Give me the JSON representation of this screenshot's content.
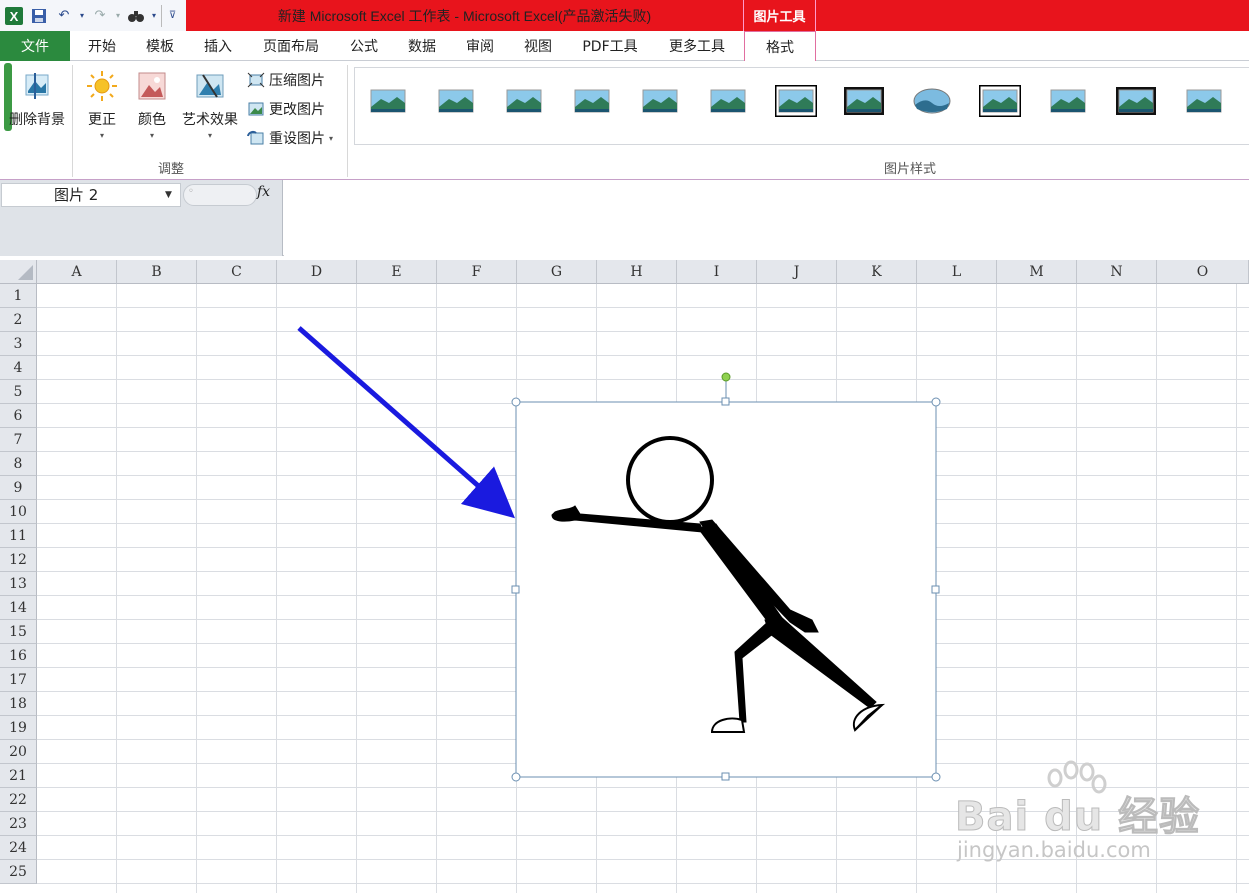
{
  "window": {
    "title": "新建 Microsoft Excel 工作表 - Microsoft Excel(产品激活失败)",
    "contextual_tab_group": "图片工具",
    "title_bar_color": "#e8141c"
  },
  "quick_access": [
    "excel-logo",
    "save",
    "undo",
    "redo",
    "find",
    "customize"
  ],
  "ribbon_tabs": {
    "file": "文件",
    "tabs": [
      "开始",
      "模板",
      "插入",
      "页面布局",
      "公式",
      "数据",
      "审阅",
      "视图",
      "PDF工具",
      "更多工具"
    ],
    "active": "格式"
  },
  "ribbon": {
    "adjust_group": {
      "remove_bg": "删除背景",
      "corrections": "更正",
      "color": "颜色",
      "artistic": "艺术效果",
      "compress": "压缩图片",
      "change": "更改图片",
      "reset": "重设图片",
      "label": "调整"
    },
    "styles_group": {
      "label": "图片样式",
      "style_count": 13
    }
  },
  "formula_bar": {
    "name_box": "图片 2",
    "fx": "fx",
    "formula": ""
  },
  "sheet": {
    "columns": [
      "A",
      "B",
      "C",
      "D",
      "E",
      "F",
      "G",
      "H",
      "I",
      "J",
      "K",
      "L",
      "M",
      "N",
      "O"
    ],
    "rows": [
      "1",
      "2",
      "3",
      "4",
      "5",
      "6",
      "7",
      "8",
      "9",
      "10",
      "11",
      "12",
      "13",
      "14",
      "15",
      "16",
      "17",
      "18",
      "19",
      "20",
      "21",
      "22",
      "23",
      "24",
      "25"
    ]
  },
  "annotation": {
    "arrow_color": "#1a1adf"
  },
  "watermark": {
    "brand": "Bai du 经验",
    "url": "jingyan.baidu.com"
  }
}
